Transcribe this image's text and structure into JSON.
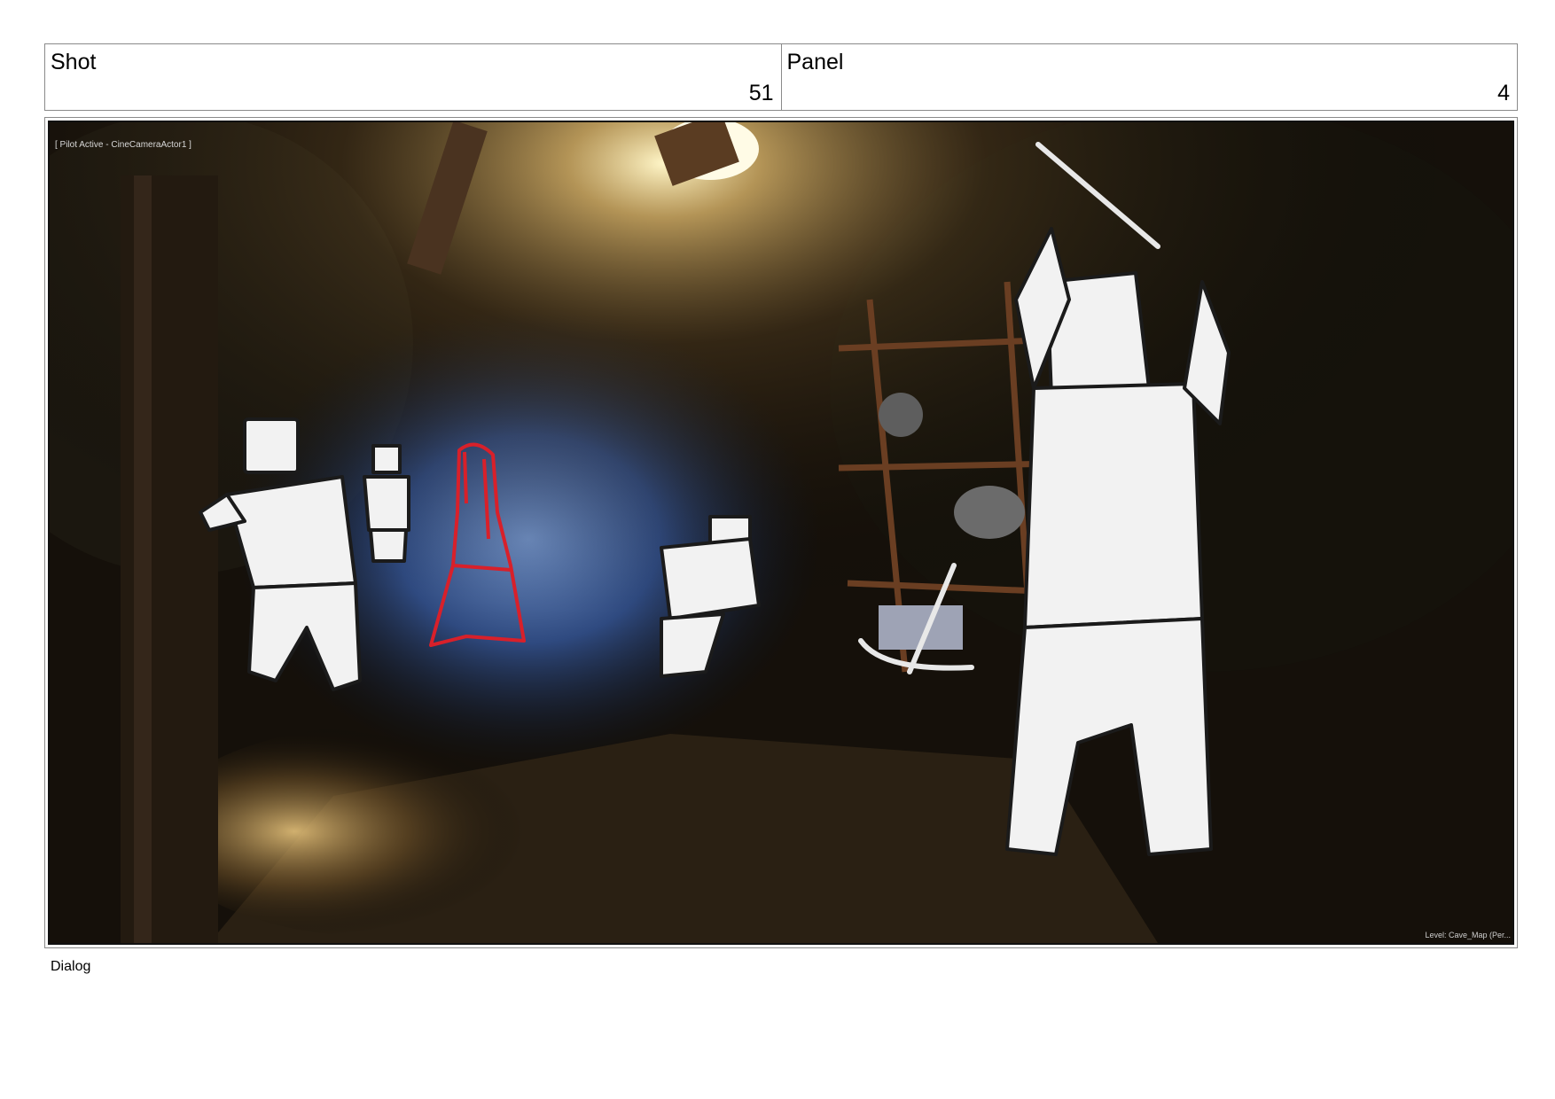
{
  "header": {
    "shot_label": "Shot",
    "shot_value": "51",
    "panel_label": "Panel",
    "panel_value": "4"
  },
  "frame": {
    "viewport_label": "[ Pilot Active - CineCameraActor1 ]",
    "level_label": "Level:  Cave_Map (Per..."
  },
  "dialog_label": "Dialog"
}
